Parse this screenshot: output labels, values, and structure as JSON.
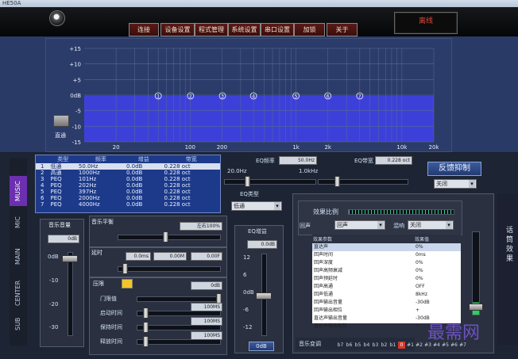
{
  "window": {
    "title": "HE50A"
  },
  "menu": [
    "连接",
    "设备设置",
    "程式管理",
    "系统设置",
    "串口设置",
    "加锁",
    "关于"
  ],
  "status": "离线",
  "graph": {
    "y_labels": [
      "+15",
      "+10",
      "+5",
      "0dB",
      "-5",
      "-10",
      "-15"
    ],
    "x_labels": [
      "20",
      "100",
      "200",
      "1k",
      "2k",
      "10k",
      "20k"
    ],
    "markers": [
      "1",
      "2",
      "3",
      "4",
      "5",
      "6",
      "7"
    ],
    "bypass_label": "直通"
  },
  "side_tabs": [
    "MUSIC",
    "MIC",
    "MAIN",
    "CENTER",
    "SUB"
  ],
  "eq_table": {
    "headers": [
      "",
      "类型",
      "频率",
      "增益",
      "带宽"
    ],
    "rows": [
      [
        "1",
        "低通",
        "50.0Hz",
        "0.0dB",
        "0.228 oct"
      ],
      [
        "2",
        "高通",
        "1000Hz",
        "0.0dB",
        "0.228 oct"
      ],
      [
        "3",
        "PEQ",
        "101Hz",
        "0.0dB",
        "0.228 oct"
      ],
      [
        "4",
        "PEQ",
        "202Hz",
        "0.0dB",
        "0.228 oct"
      ],
      [
        "5",
        "PEQ",
        "397Hz",
        "0.0dB",
        "0.228 oct"
      ],
      [
        "6",
        "PEQ",
        "2000Hz",
        "0.0dB",
        "0.228 oct"
      ],
      [
        "7",
        "PEQ",
        "4000Hz",
        "0.0dB",
        "0.228 oct"
      ]
    ]
  },
  "eq_controls": {
    "freq_label": "EQ频率",
    "freq_value": "50.0Hz",
    "bw_label": "EQ带宽",
    "bw_value": "0.228 oct",
    "freq_min": "20.0Hz",
    "freq_max": "1.0kHz",
    "type_label": "EQ类型",
    "type_value": "低通",
    "gain_label": "EQ增益",
    "gain_value": "0.0dB",
    "gain_scale": [
      "12",
      "6",
      "0dB",
      "-6",
      "-12"
    ],
    "gain_button": "0dB"
  },
  "music_volume": {
    "title": "音乐音量",
    "value": "0dB",
    "scale": [
      "0dB",
      "-10",
      "-20",
      "-30"
    ]
  },
  "balance": {
    "title": "音乐平衡",
    "value": "左右100%"
  },
  "delay": {
    "title": "延时",
    "values": [
      "0.0ms",
      "0.00M",
      "0.00F"
    ]
  },
  "limiter": {
    "title": "压限",
    "value": "0dB",
    "rows": [
      {
        "label": "门限值",
        "value": ""
      },
      {
        "label": "启动时间",
        "value": "100MS"
      },
      {
        "label": "保持时间",
        "value": "100MS"
      },
      {
        "label": "释放时间",
        "value": "100MS"
      }
    ]
  },
  "feedback": {
    "button": "反馈抑制",
    "select": "关闭"
  },
  "effects": {
    "ratio_label": "效果比例",
    "echo_label": "回声",
    "echo_value": "回声",
    "mode_label": "混响",
    "mode_value": "关闭",
    "headers": [
      "效果参数",
      "效果值"
    ],
    "rows": [
      [
        "直达声",
        "0%"
      ],
      [
        "回声时间",
        "0ms"
      ],
      [
        "回声深度",
        "0%"
      ],
      [
        "回声高频衰减",
        "0%"
      ],
      [
        "回声预延时",
        "0%"
      ],
      [
        "回声高通",
        "OFF"
      ],
      [
        "回声低通",
        "8kHz"
      ],
      [
        "回声输出音量",
        "-30dB"
      ],
      [
        "回声输出相位",
        "+"
      ],
      [
        "直达声输出音量",
        "-30dB"
      ],
      [
        "直达声输出相位",
        "+"
      ]
    ]
  },
  "keyshift": {
    "label": "音乐变调",
    "keys": [
      "b7",
      "b6",
      "b5",
      "b4",
      "b3",
      "b2",
      "b1",
      "0",
      "#1",
      "#2",
      "#3",
      "#4",
      "#5",
      "#6",
      "#7"
    ]
  },
  "right_panel": "话筒效果",
  "watermark": "最需网",
  "colors": {
    "accent": "#3d40d8",
    "status_red": "#e04a3a",
    "tab_active": "#6b2fb0"
  }
}
